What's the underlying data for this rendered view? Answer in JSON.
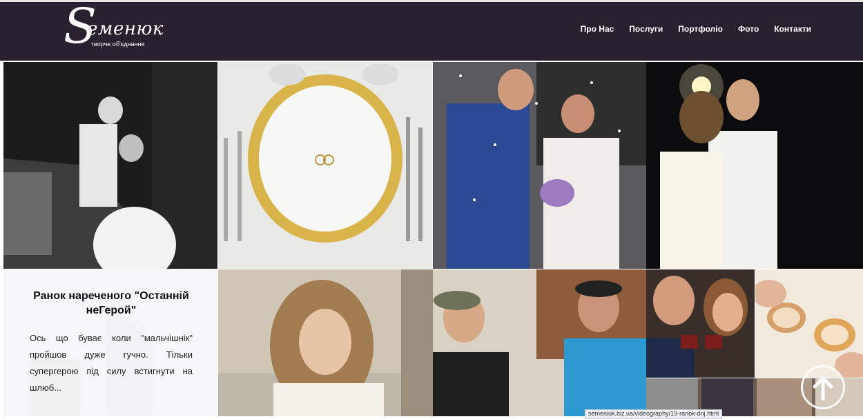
{
  "header": {
    "logo_letter": "S",
    "logo_word": "еменюк",
    "logo_tagline": "творче об'єднання",
    "nav": [
      "Про Нас",
      "Послуги",
      "Портфоліо",
      "Фото",
      "Контакти"
    ]
  },
  "story": {
    "title": "Ранок нареченого \"Останній неГерой\"",
    "text": "Ось що буває коли \"мальчішнік\" пройшов дуже гучно. Тільки супергерою під силу встигнути на шлюб..."
  },
  "statusbar": {
    "url": "semeniuk.biz.ua/videography/19-ranok-dnj.html"
  },
  "colors": {
    "header_bg": "#2a2130",
    "nav_text": "#ffffff",
    "story_overlay": "#f5f6f8"
  },
  "icons": {
    "scroll_top": "arrow-up-circle-icon"
  }
}
